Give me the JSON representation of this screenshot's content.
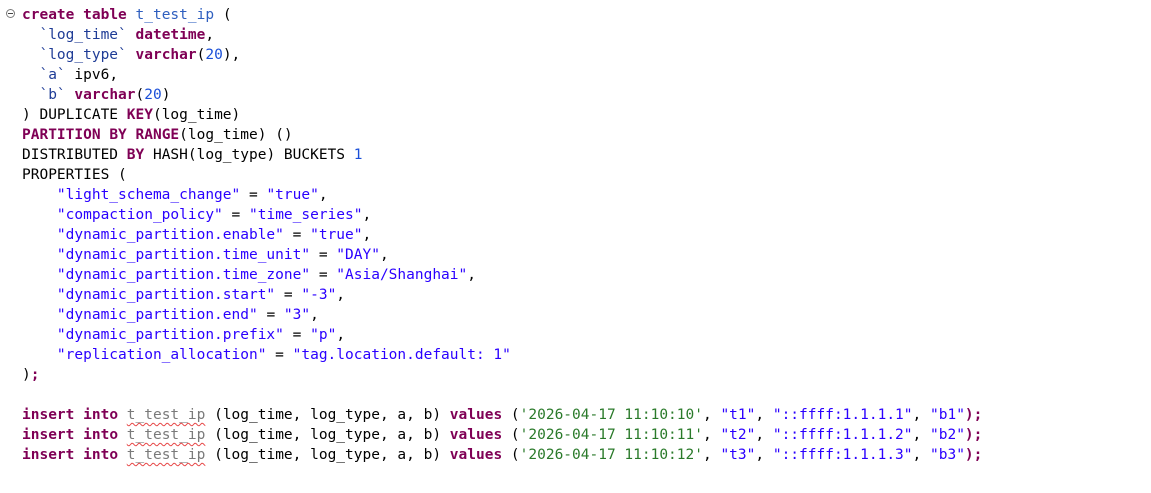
{
  "editor": {
    "ddl": {
      "l1": {
        "kw1": "create",
        "kw2": "table",
        "name": "t_test_ip",
        "open": "("
      },
      "l2": {
        "col": "`log_time`",
        "type": "datetime",
        "sep": ","
      },
      "l3": {
        "col": "`log_type`",
        "type": "varchar",
        "open": "(",
        "num": "20",
        "close": "),"
      },
      "l4": {
        "col": "`a`",
        "type": "ipv6,"
      },
      "l5": {
        "col": "`b`",
        "type": "varchar",
        "open": "(",
        "num": "20",
        "close": ")"
      },
      "l6": {
        "pre": ") DUPLICATE ",
        "kw": "KEY",
        "post": "(log_time)"
      },
      "l7": {
        "kw1": "PARTITION",
        "kw2": "BY",
        "kw3": "RANGE",
        "post": "(log_time) ()"
      },
      "l8": {
        "pre": "DISTRIBUTED ",
        "kw": "BY",
        "mid": " HASH(log_type) BUCKETS ",
        "num": "1"
      },
      "l9": {
        "text": "PROPERTIES ("
      },
      "props": [
        {
          "key": "\"light_schema_change\"",
          "eq": " = ",
          "val": "\"true\"",
          "sep": ","
        },
        {
          "key": "\"compaction_policy\"",
          "eq": " = ",
          "val": "\"time_series\"",
          "sep": ","
        },
        {
          "key": "\"dynamic_partition.enable\"",
          "eq": " = ",
          "val": "\"true\"",
          "sep": ","
        },
        {
          "key": "\"dynamic_partition.time_unit\"",
          "eq": " = ",
          "val": "\"DAY\"",
          "sep": ","
        },
        {
          "key": "\"dynamic_partition.time_zone\"",
          "eq": " = ",
          "val": "\"Asia/Shanghai\"",
          "sep": ","
        },
        {
          "key": "\"dynamic_partition.start\"",
          "eq": " = ",
          "val": "\"-3\"",
          "sep": ","
        },
        {
          "key": "\"dynamic_partition.end\"",
          "eq": " = ",
          "val": "\"3\"",
          "sep": ","
        },
        {
          "key": "\"dynamic_partition.prefix\"",
          "eq": " = ",
          "val": "\"p\"",
          "sep": ","
        },
        {
          "key": "\"replication_allocation\"",
          "eq": " = ",
          "val": "\"tag.location.default: 1\"",
          "sep": ""
        }
      ],
      "close": ")",
      "semi": ";"
    },
    "inserts": [
      {
        "kw1": "insert",
        "kw2": "into",
        "table": "t_test_ip",
        "cols": " (log_time, log_type, a, b) ",
        "kw3": "values",
        "open": " (",
        "ts": "'2026-04-17 11:10:10'",
        "v2": "\"t1\"",
        "v3": "\"::ffff:1.1.1.1\"",
        "v4": "\"b1\"",
        "close": ");"
      },
      {
        "kw1": "insert",
        "kw2": "into",
        "table": "t_test_ip",
        "cols": " (log_time, log_type, a, b) ",
        "kw3": "values",
        "open": " (",
        "ts": "'2026-04-17 11:10:11'",
        "v2": "\"t2\"",
        "v3": "\"::ffff:1.1.1.2\"",
        "v4": "\"b2\"",
        "close": ");"
      },
      {
        "kw1": "insert",
        "kw2": "into",
        "table": "t_test_ip",
        "cols": " (log_time, log_type, a, b) ",
        "kw3": "values",
        "open": " (",
        "ts": "'2026-04-17 11:10:12'",
        "v2": "\"t3\"",
        "v3": "\"::ffff:1.1.1.3\"",
        "v4": "\"b3\"",
        "close": ");"
      }
    ],
    "comma": ", "
  }
}
